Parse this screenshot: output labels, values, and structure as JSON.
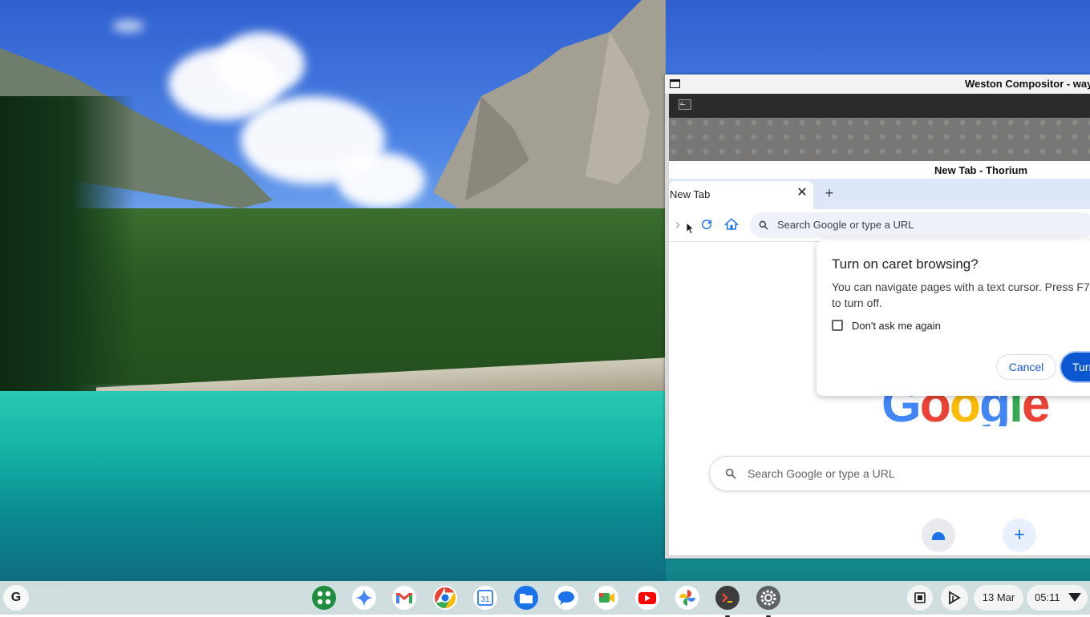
{
  "weston": {
    "title": "Weston Compositor - wayla"
  },
  "browser": {
    "window_title": "New Tab - Thorium",
    "tab_label": "New Tab",
    "tab_close": "✕",
    "new_tab": "+",
    "omnibox_placeholder": "Search Google or type a URL",
    "ntp_search_placeholder": "Search Google or type a URL",
    "google_logo": [
      "G",
      "o",
      "o",
      "g",
      "l",
      "e"
    ],
    "shortcut_add": "+"
  },
  "dialog": {
    "title": "Turn on caret browsing?",
    "body": "You can navigate pages with a text cursor. Press F7 to turn off.",
    "checkbox_label": "Don't ask me again",
    "cancel_label": "Cancel",
    "confirm_label": "Turn on"
  },
  "shelf": {
    "launcher_label": "G",
    "apps": [
      "app-launcher-grid",
      "gemini",
      "gmail",
      "chrome",
      "calendar",
      "files",
      "messages",
      "meet",
      "youtube",
      "photos",
      "terminal",
      "settings"
    ],
    "calendar_day": "31",
    "date": "13 Mar",
    "time": "05:11"
  },
  "colors": {
    "accent": "#0b57d0",
    "tab_strip": "#dde7f8",
    "google_blue": "#4285f4",
    "google_red": "#ea4335",
    "google_yellow": "#fbbc05",
    "google_green": "#34a853"
  }
}
